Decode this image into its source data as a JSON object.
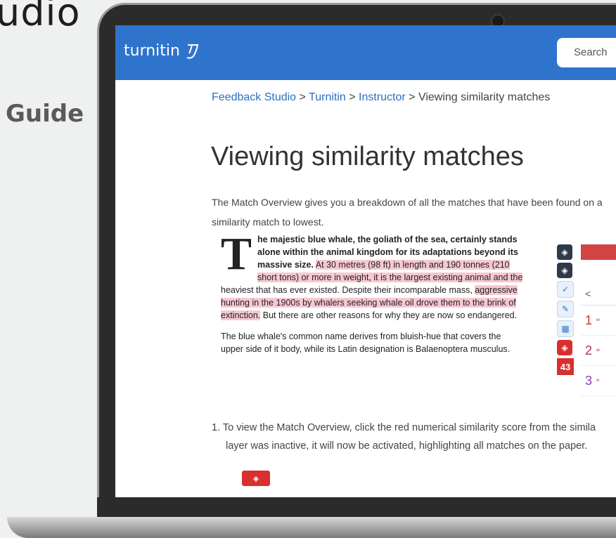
{
  "background": {
    "title_fragment": "udio",
    "subtitle": "Guide"
  },
  "header": {
    "logo_text": "turnitin",
    "search_placeholder": "Search"
  },
  "breadcrumb": {
    "items": [
      "Feedback Studio",
      "Turnitin",
      "Instructor"
    ],
    "separator": " > ",
    "current": "Viewing similarity matches"
  },
  "main": {
    "title": "Viewing similarity matches",
    "intro_line1": "The Match Overview gives you a breakdown of all the matches that have been found on a",
    "intro_line2": "similarity match to lowest."
  },
  "document": {
    "dropcap": "T",
    "p1_bold": "he majestic blue whale, the goliath of the sea, certainly stands alone within the animal kingdom for its adaptations beyond its massive size.",
    "p1_hl1": "At 30 metres (98 ft) in length and 190 tonnes (210 short tons) or more in weight, it is the largest existing animal and the",
    "p1_plain1": "heaviest that has ever existed. Despite their incomparable mass,",
    "p1_hl2": "aggressive hunting in the 1900s by whalers seeking whale oil drove them to the brink of extinction.",
    "p1_plain2": "But there are other reasons for why they are now so endangered.",
    "p2": "The blue whale's common name derives from bluish-hue that covers the upper side of it body, while its Latin designation is Balaenoptera musculus."
  },
  "panel": {
    "score": "43",
    "nav_prev": "<",
    "matches": [
      {
        "num": "1",
        "text": "er",
        "color": "#d92f2f"
      },
      {
        "num": "2",
        "text": "ar",
        "color": "#b0306a"
      },
      {
        "num": "3",
        "text": "w",
        "color": "#8a3ab0"
      }
    ]
  },
  "steps": {
    "step1_line1": "1.  To view the Match Overview, click the red numerical similarity score from the simila",
    "step1_line2": "layer was inactive, it will now be activated, highlighting all matches on the paper."
  },
  "colors": {
    "brand_blue": "#2f74cc",
    "match_red": "#d92f2f",
    "highlight": "#f7c8d2"
  }
}
